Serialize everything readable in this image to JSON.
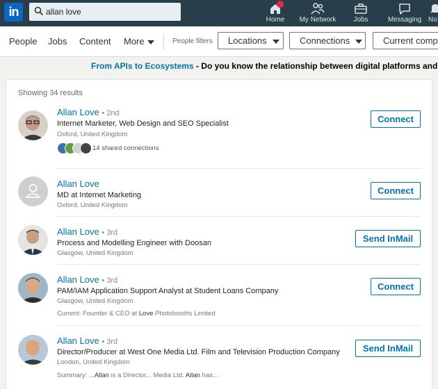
{
  "topbar": {
    "logo": "in",
    "search": {
      "value": "allan love",
      "icon": "search-icon"
    },
    "nav": [
      {
        "label": "Home",
        "icon": "home-icon",
        "badge": true
      },
      {
        "label": "My Network",
        "icon": "network-icon"
      },
      {
        "label": "Jobs",
        "icon": "briefcase-icon"
      },
      {
        "label": "Messaging",
        "icon": "messaging-icon"
      },
      {
        "label": "No",
        "icon": "bell-icon"
      }
    ]
  },
  "filterbar": {
    "tabs": [
      "People",
      "Jobs",
      "Content",
      "More"
    ],
    "filters_label": "People filters",
    "buttons": [
      "Locations",
      "Connections",
      "Current compa"
    ]
  },
  "promo": {
    "link": "From APIs to Ecosystems",
    "text": " - Do you know the relationship between digital platforms and th"
  },
  "results": {
    "count": "Showing 34 results",
    "people": [
      {
        "name": "Allan Love",
        "degree": "• 2nd",
        "title": "Internet Marketer, Web Design and SEO Specialist",
        "location": "Oxford, United Kingdom",
        "shared": "14 shared connections",
        "action": "Connect"
      },
      {
        "name": "Allan Love",
        "degree": "",
        "title": "MD at Internet Marketing",
        "location": "Oxford, United Kingdom",
        "action": "Connect"
      },
      {
        "name": "Allan Love",
        "degree": "• 3rd",
        "title": "Process and Modelling Engineer with Doosan",
        "location": "Glasgow, United Kingdom",
        "action": "Send InMail"
      },
      {
        "name": "Allan Love",
        "degree": "• 3rd",
        "title": "PAM/IAM Application Support Analyst at Student Loans Company",
        "location": "Glasgow, United Kingdom",
        "extra_prefix": "Current: Founder & CEO at ",
        "extra_bold": "Love",
        "extra_suffix": " Photobooths Limited",
        "action": "Connect"
      },
      {
        "name": "Allan Love",
        "degree": "• 3rd",
        "title": "Director/Producer at West One Media Ltd. Film and Television Production Company",
        "location": "London, United Kingdom",
        "extra_prefix": "Summary: ...",
        "extra_bold": "Allan",
        "extra_suffix": " is a Director... Media Ltd. ",
        "extra_bold2": "Allan",
        "extra_suffix2": " has...",
        "action": "Send InMail"
      }
    ]
  },
  "colors": {
    "topbar": "#283e4a",
    "brand": "#0a66c2",
    "link": "#0073b1",
    "badge": "#e0284e"
  }
}
